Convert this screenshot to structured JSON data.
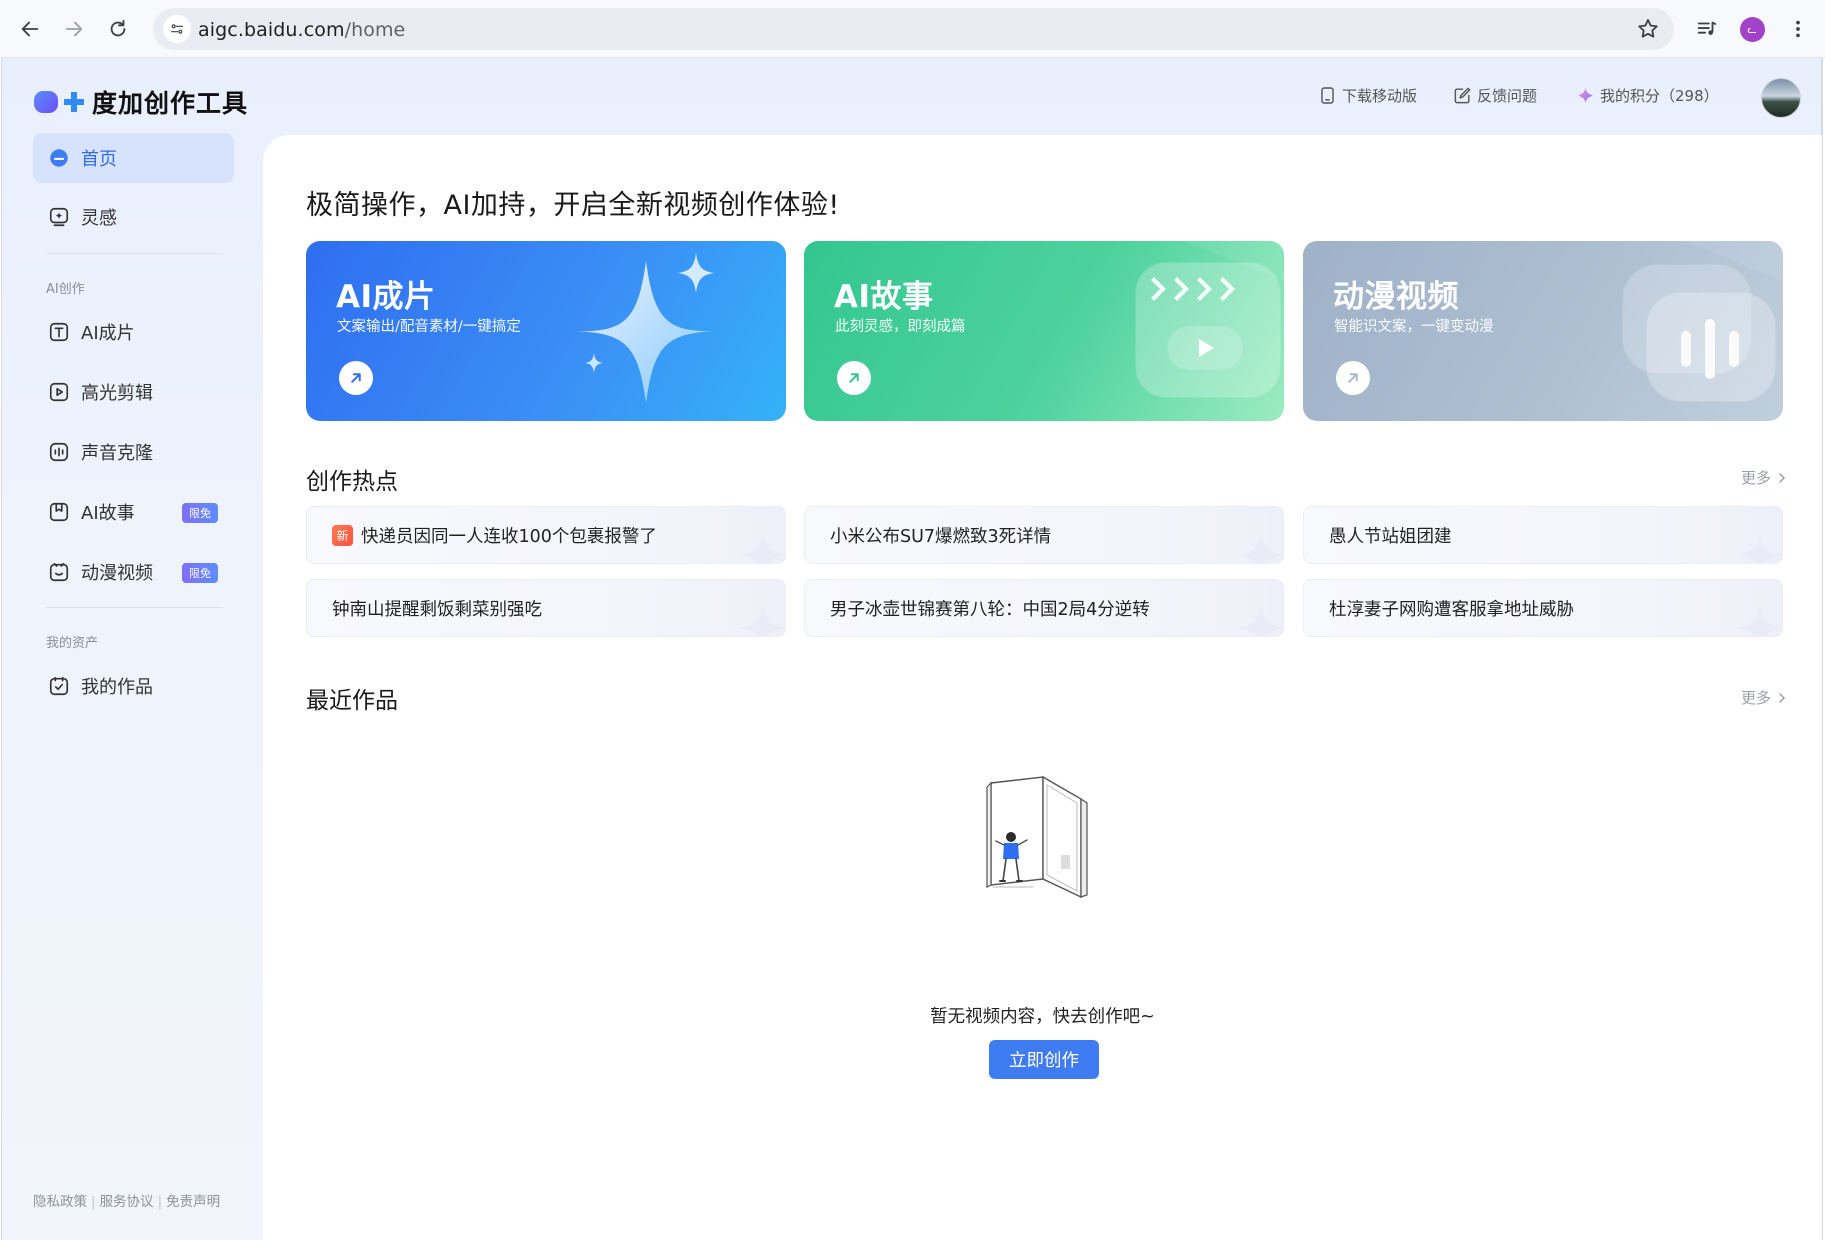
{
  "browser": {
    "url_host": "aigc.baidu.com",
    "url_path": "/home",
    "profile_initial": "ᓚ"
  },
  "brand": {
    "name": "度加创作工具"
  },
  "topnav": {
    "download": "下载移动版",
    "feedback": "反馈问题",
    "points": "我的积分（298）"
  },
  "sidebar": {
    "items": [
      {
        "label": "首页"
      },
      {
        "label": "灵感"
      }
    ],
    "group_ai": "AI创作",
    "ai_items": [
      {
        "label": "AI成片"
      },
      {
        "label": "高光剪辑"
      },
      {
        "label": "声音克隆"
      },
      {
        "label": "AI故事",
        "badge": "限免"
      },
      {
        "label": "动漫视频",
        "badge": "限免"
      }
    ],
    "group_assets": "我的资产",
    "asset_items": [
      {
        "label": "我的作品"
      }
    ],
    "footer": [
      "隐私政策",
      "服务协议",
      "免责声明"
    ]
  },
  "main": {
    "title": "极简操作，AI加持，开启全新视频创作体验!",
    "cards": [
      {
        "title": "AI成片",
        "subtitle": "文案输出/配音素材/一键搞定"
      },
      {
        "title": "AI故事",
        "subtitle": "此刻灵感，即刻成篇"
      },
      {
        "title": "动漫视频",
        "subtitle": "智能识文案，一键变动漫"
      }
    ],
    "hot_title": "创作热点",
    "more": "更多",
    "new_tag": "新",
    "hot_items": [
      "快递员因同一人连收100个包裹报警了",
      "小米公布SU7爆燃致3死详情",
      "愚人节站姐团建",
      "钟南山提醒剩饭剩菜别强吃",
      "男子冰壶世锦赛第八轮：中国2局4分逆转",
      "杜淳妻子网购遭客服拿地址威胁"
    ],
    "recent_title": "最近作品",
    "empty_text": "暂无视频内容，快去创作吧~",
    "create_button": "立即创作"
  },
  "colors": {
    "accent": "#3f7cf2",
    "card_blue": "#2f6ef0",
    "card_green": "#33c690",
    "card_gray": "#a8b9cd"
  }
}
